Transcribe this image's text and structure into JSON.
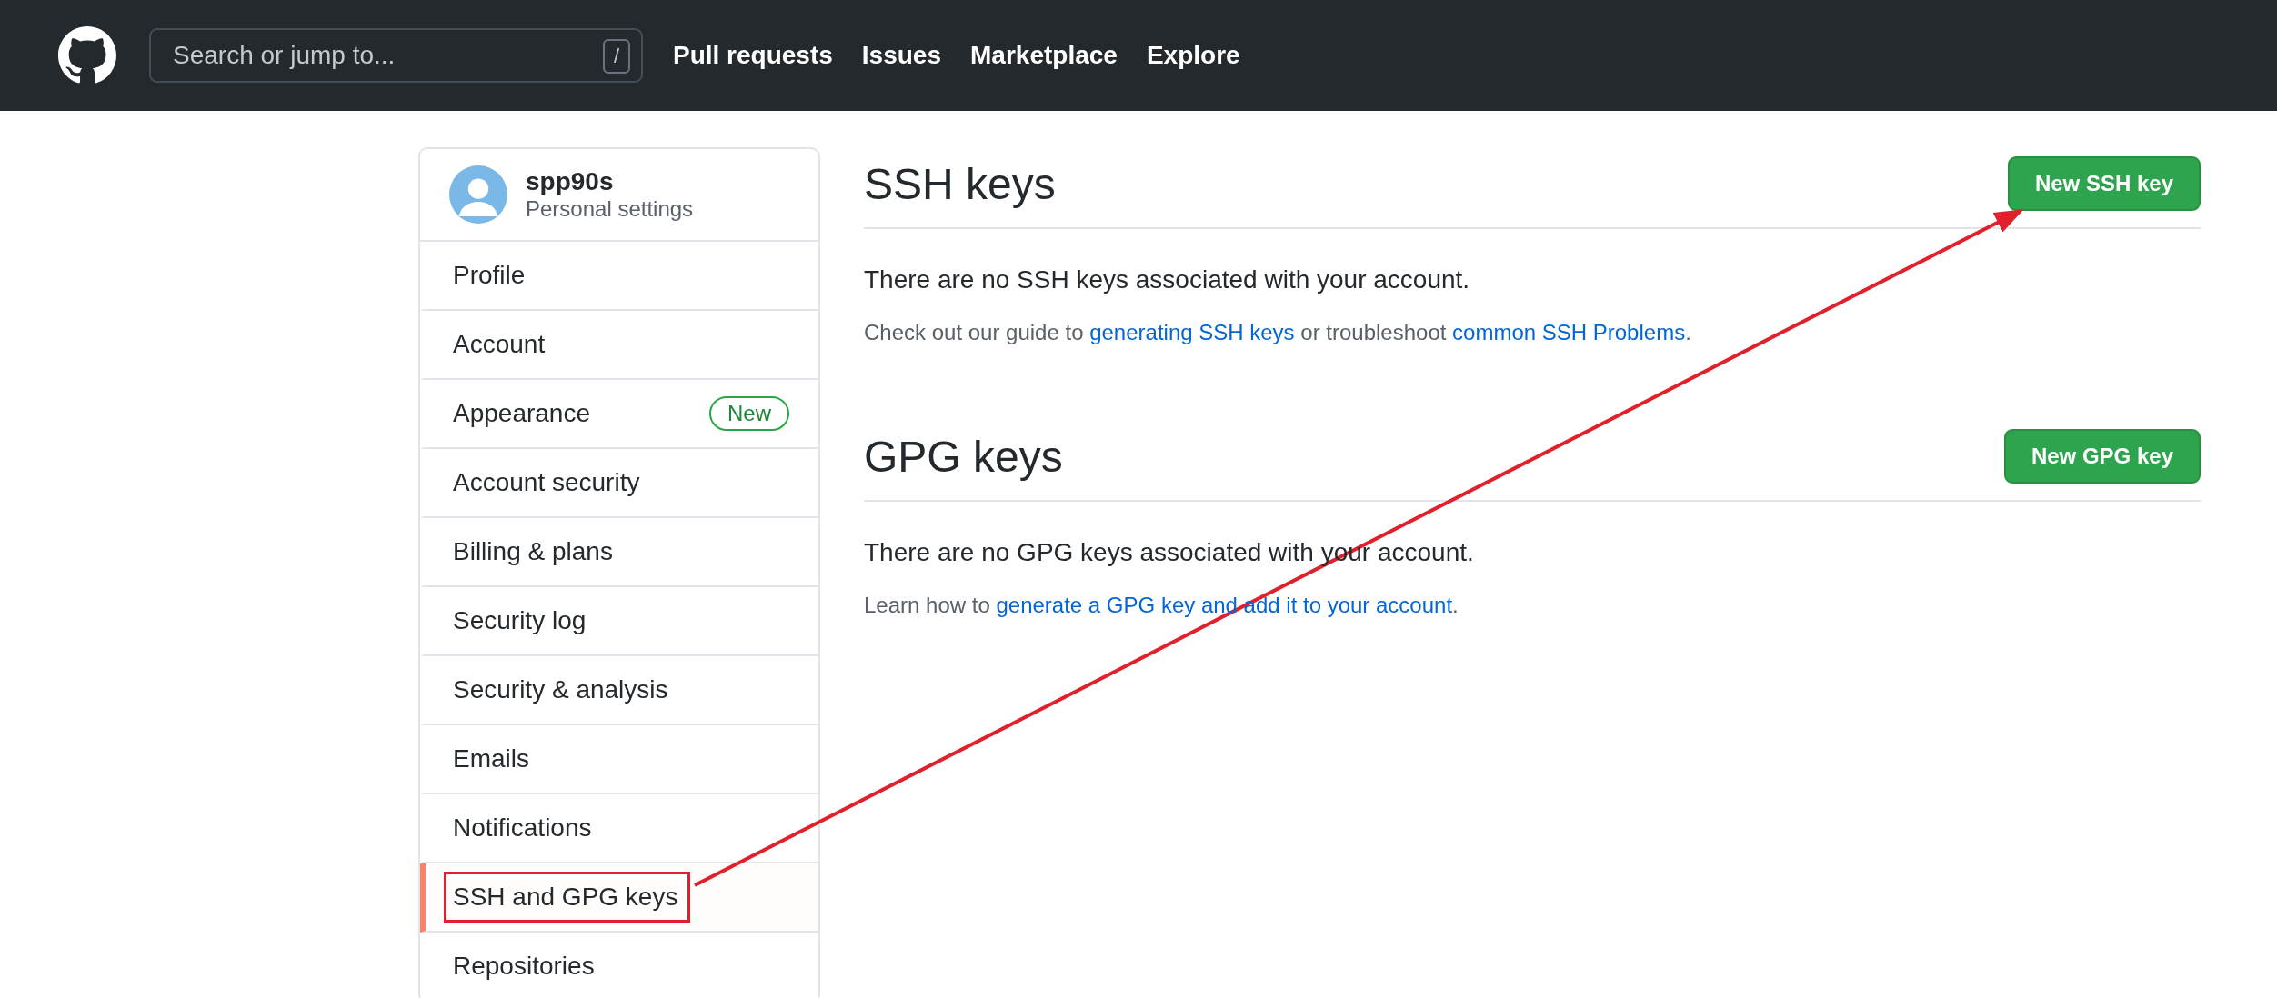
{
  "header": {
    "search": {
      "placeholder": "Search or jump to...",
      "shortcut": "/"
    },
    "nav": [
      "Pull requests",
      "Issues",
      "Marketplace",
      "Explore"
    ]
  },
  "sidebar": {
    "user": {
      "name": "spp90s",
      "subtitle": "Personal settings"
    },
    "items": [
      {
        "label": "Profile",
        "selected": false,
        "highlighted": false
      },
      {
        "label": "Account",
        "selected": false,
        "highlighted": false
      },
      {
        "label": "Appearance",
        "selected": false,
        "highlighted": false,
        "badge": "New"
      },
      {
        "label": "Account security",
        "selected": false,
        "highlighted": false
      },
      {
        "label": "Billing & plans",
        "selected": false,
        "highlighted": false
      },
      {
        "label": "Security log",
        "selected": false,
        "highlighted": false
      },
      {
        "label": "Security & analysis",
        "selected": false,
        "highlighted": false
      },
      {
        "label": "Emails",
        "selected": false,
        "highlighted": false
      },
      {
        "label": "Notifications",
        "selected": false,
        "highlighted": false
      },
      {
        "label": "SSH and GPG keys",
        "selected": true,
        "highlighted": true
      },
      {
        "label": "Repositories",
        "selected": false,
        "highlighted": false
      }
    ]
  },
  "sections": [
    {
      "title": "SSH keys",
      "button": "New SSH key",
      "empty_text": "There are no SSH keys associated with your account.",
      "help": [
        {
          "kind": "text",
          "text": "Check out our guide to "
        },
        {
          "kind": "link",
          "text": "generating SSH keys"
        },
        {
          "kind": "text",
          "text": " or troubleshoot "
        },
        {
          "kind": "link",
          "text": "common SSH Problems"
        },
        {
          "kind": "text",
          "text": "."
        }
      ]
    },
    {
      "title": "GPG keys",
      "button": "New GPG key",
      "empty_text": "There are no GPG keys associated with your account.",
      "help": [
        {
          "kind": "text",
          "text": "Learn how to "
        },
        {
          "kind": "link",
          "text": "generate a GPG key and add it to your account"
        },
        {
          "kind": "text",
          "text": "."
        }
      ]
    }
  ]
}
